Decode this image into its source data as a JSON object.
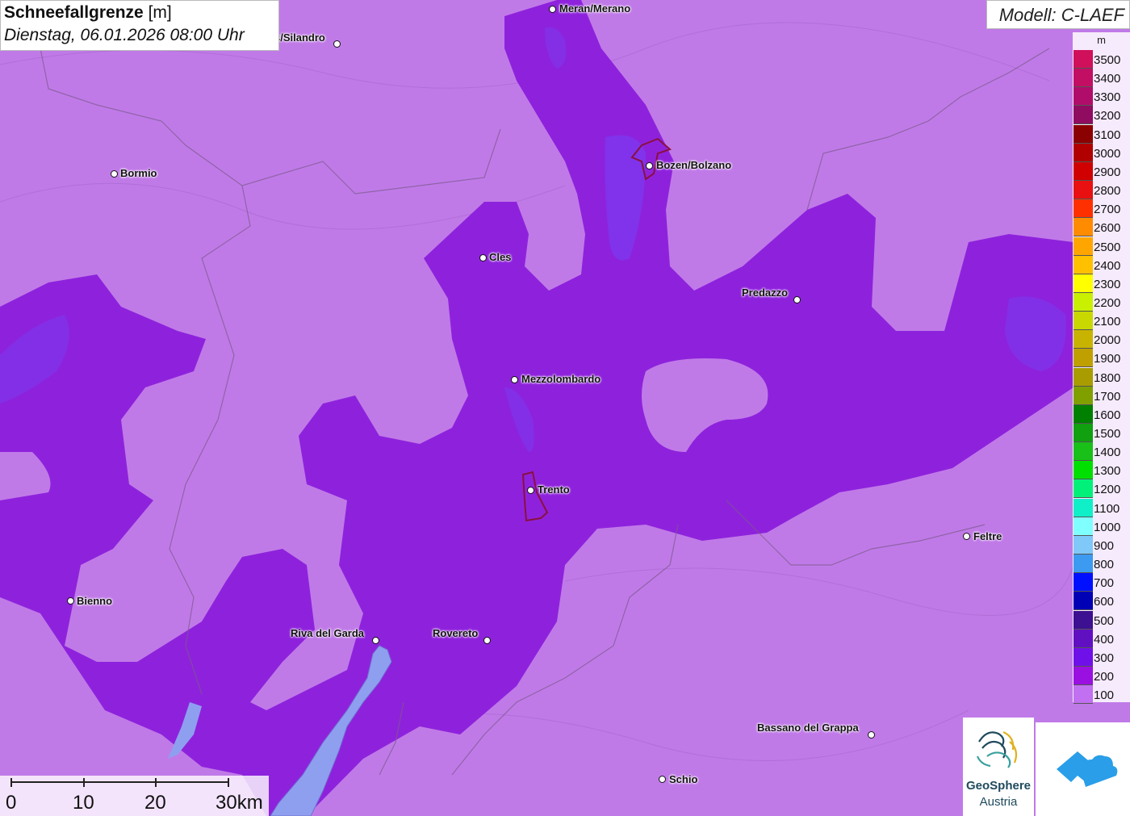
{
  "title": {
    "bold": "Schneefallgrenze",
    "unit": "[m]",
    "datetime": "Dienstag, 06.01.2026 08:00 Uhr"
  },
  "model": "Modell: C-LAEF",
  "legend": {
    "unit": "m",
    "entries": [
      {
        "label": "3500",
        "color": "#d0105a"
      },
      {
        "label": "3400",
        "color": "#c20e63"
      },
      {
        "label": "3300",
        "color": "#b00d6a"
      },
      {
        "label": "3200",
        "color": "#8f0c60"
      },
      {
        "label": "3100",
        "color": "#8b0000"
      },
      {
        "label": "3000",
        "color": "#b00000"
      },
      {
        "label": "2900",
        "color": "#d00000"
      },
      {
        "label": "2800",
        "color": "#e81010"
      },
      {
        "label": "2700",
        "color": "#ff3000"
      },
      {
        "label": "2600",
        "color": "#ff8c00"
      },
      {
        "label": "2500",
        "color": "#ffa500"
      },
      {
        "label": "2400",
        "color": "#ffc000"
      },
      {
        "label": "2300",
        "color": "#ffff00"
      },
      {
        "label": "2200",
        "color": "#c8f000"
      },
      {
        "label": "2100",
        "color": "#c8d800"
      },
      {
        "label": "2000",
        "color": "#c8b400"
      },
      {
        "label": "1900",
        "color": "#c0a000"
      },
      {
        "label": "1800",
        "color": "#a89c00"
      },
      {
        "label": "1700",
        "color": "#80a000"
      },
      {
        "label": "1600",
        "color": "#008000"
      },
      {
        "label": "1500",
        "color": "#10a010"
      },
      {
        "label": "1400",
        "color": "#18c018"
      },
      {
        "label": "1300",
        "color": "#00e000"
      },
      {
        "label": "1200",
        "color": "#00f07a"
      },
      {
        "label": "1100",
        "color": "#10f0c8"
      },
      {
        "label": "1000",
        "color": "#80ffff"
      },
      {
        "label": "900",
        "color": "#80c8f8"
      },
      {
        "label": "800",
        "color": "#3c9bf0"
      },
      {
        "label": "700",
        "color": "#0010ff"
      },
      {
        "label": "600",
        "color": "#0000b4"
      },
      {
        "label": "500",
        "color": "#3c1090"
      },
      {
        "label": "400",
        "color": "#6010c0"
      },
      {
        "label": "300",
        "color": "#7010e8"
      },
      {
        "label": "200",
        "color": "#9a10e0"
      },
      {
        "label": "100",
        "color": "#c070f0"
      }
    ]
  },
  "cities": [
    {
      "name": "Meran/Merano"
    },
    {
      "name": "s/Silandro"
    },
    {
      "name": "Bormio"
    },
    {
      "name": "Bozen/Bolzano"
    },
    {
      "name": "Cles"
    },
    {
      "name": "Predazzo"
    },
    {
      "name": "Mezzolombardo"
    },
    {
      "name": "Trento"
    },
    {
      "name": "Feltre"
    },
    {
      "name": "Bienno"
    },
    {
      "name": "Riva del Garda"
    },
    {
      "name": "Rovereto"
    },
    {
      "name": "Bassano del Grappa"
    },
    {
      "name": "Schio"
    }
  ],
  "scalebar": {
    "labels": [
      "0",
      "10",
      "20",
      "30km"
    ]
  },
  "logos": {
    "geosphere_name": "GeoSphere",
    "geosphere_sub": "Austria"
  },
  "colors": {
    "light_region": "#c07ae8",
    "mid_region": "#9a2fe0",
    "dark_region": "#8a1fd8",
    "lake": "#9fa8f0",
    "city_outline": "#8a1040"
  }
}
